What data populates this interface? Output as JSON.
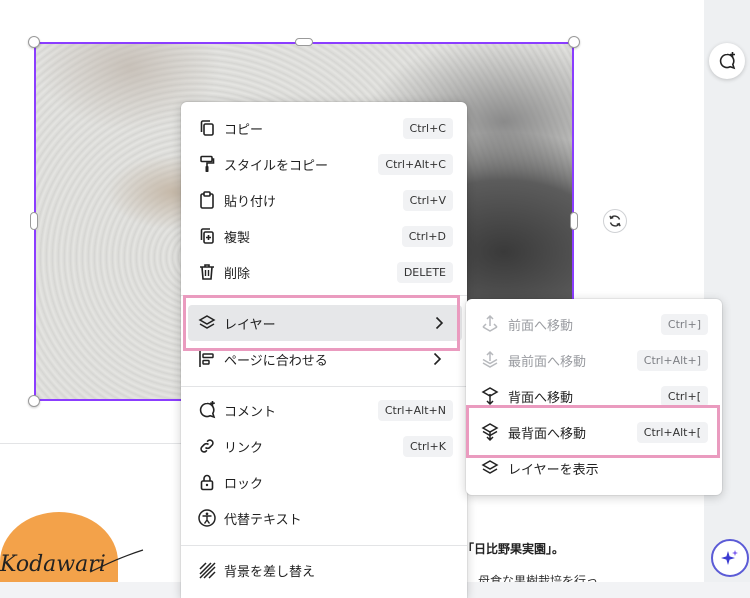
{
  "context_menu": {
    "items": [
      {
        "label": "コピー",
        "shortcut": "Ctrl+C"
      },
      {
        "label": "スタイルをコピー",
        "shortcut": "Ctrl+Alt+C"
      },
      {
        "label": "貼り付け",
        "shortcut": "Ctrl+V"
      },
      {
        "label": "複製",
        "shortcut": "Ctrl+D"
      },
      {
        "label": "削除",
        "shortcut": "DELETE"
      },
      {
        "label": "レイヤー"
      },
      {
        "label": "ページに合わせる"
      },
      {
        "label": "コメント",
        "shortcut": "Ctrl+Alt+N"
      },
      {
        "label": "リンク",
        "shortcut": "Ctrl+K"
      },
      {
        "label": "ロック"
      },
      {
        "label": "代替テキスト"
      },
      {
        "label": "背景を差し替え"
      }
    ]
  },
  "layer_submenu": {
    "items": [
      {
        "label": "前面へ移動",
        "shortcut": "Ctrl+]",
        "disabled": true
      },
      {
        "label": "最前面へ移動",
        "shortcut": "Ctrl+Alt+]",
        "disabled": true
      },
      {
        "label": "背面へ移動",
        "shortcut": "Ctrl+["
      },
      {
        "label": "最背面へ移動",
        "shortcut": "Ctrl+Alt+["
      },
      {
        "label": "レイヤーを表示"
      }
    ]
  },
  "canvas": {
    "script_text": "Kodawari",
    "text_line_1": "「日比野果実園」。",
    "text_line_2": "母食な果樹栽培を行っ"
  },
  "colors": {
    "selection": "#8b3dff",
    "highlight": "#ea9bbf",
    "accent_blob": "#f3a24a"
  }
}
